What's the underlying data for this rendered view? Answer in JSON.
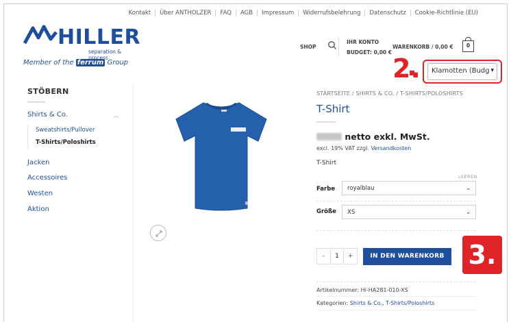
{
  "topnav": [
    "Kontakt",
    "Über ANTHOLZER",
    "FAQ",
    "AGB",
    "Impressum",
    "Widerrufsbelehrung",
    "Datenschutz",
    "Cookie-Richtlinie (EU)"
  ],
  "logo": {
    "brand": "HILLER",
    "tagline": "separation & process",
    "member_prefix": "Member of the",
    "member_brand": "ferrum",
    "member_suffix": "Group"
  },
  "header": {
    "shop": "SHOP",
    "account_line1": "IHR KONTO",
    "account_line2": "BUDGET: 0,00 €",
    "cart": "WARENKORB / 0,00 €",
    "cart_count": "0"
  },
  "annotations": {
    "step2": "2.",
    "step3": "3."
  },
  "lang_select": {
    "value": "Klamotten (Budg"
  },
  "sidebar": {
    "title": "STÖBERN",
    "items": [
      {
        "label": "Shirts & Co."
      },
      {
        "label": "Jacken"
      },
      {
        "label": "Accessoires"
      },
      {
        "label": "Westen"
      },
      {
        "label": "Aktion"
      }
    ],
    "subitems": [
      {
        "label": "Sweatshirts/Pullover"
      },
      {
        "label": "T-Shirts/Poloshirts"
      }
    ]
  },
  "product": {
    "breadcrumb": "STARTSEITE / SHIRTS & CO. / T-SHIRTS/POLOSHIRTS",
    "title": "T-Shirt",
    "price_suffix": "netto exkl. MwSt.",
    "vat_text": "excl. 19% VAT zzgl.",
    "vat_link": "Versandkosten",
    "description": "T-Shirt",
    "reset": "LEEREN",
    "farbe_label": "Farbe",
    "farbe_value": "royalblau",
    "groesse_label": "Größe",
    "groesse_value": "XS",
    "qty_minus": "-",
    "qty_value": "1",
    "qty_plus": "+",
    "add_to_cart": "IN DEN WARENKORB",
    "sku_label": "Artikelnummer:",
    "sku_value": "Hi-HA281-010-XS",
    "cat_label": "Kategorien:",
    "cat_links": "Shirts & Co., T-Shirts/Poloshirts"
  },
  "colors": {
    "brand_blue": "#1f4f9c",
    "annotation_red": "#e02326",
    "shirt_blue": "#2560ad"
  }
}
